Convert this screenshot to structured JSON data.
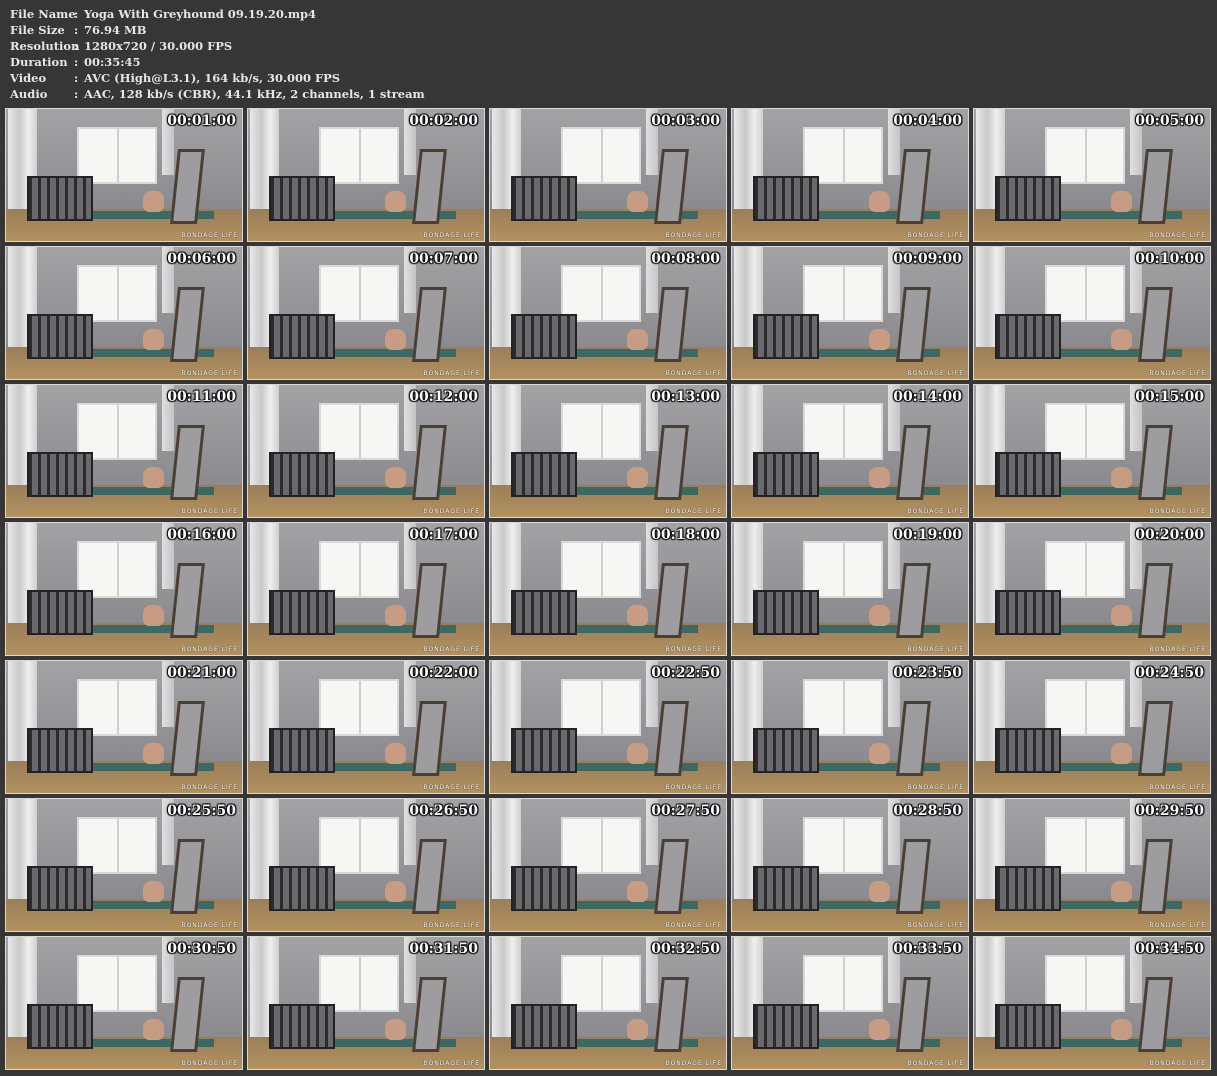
{
  "info": [
    {
      "label": "File Name",
      "sep": ":",
      "value": "Yoga With Greyhound 09.19.20.mp4"
    },
    {
      "label": "File Size",
      "sep": ":",
      "value": "76.94 MB"
    },
    {
      "label": "Resolution",
      "sep": ":",
      "value": "1280x720 / 30.000 FPS"
    },
    {
      "label": "Duration",
      "sep": ":",
      "value": "00:35:45"
    },
    {
      "label": "Video",
      "sep": ":",
      "value": "AVC (High@L3.1), 164 kb/s, 30.000 FPS"
    },
    {
      "label": "Audio",
      "sep": ":",
      "value": "AAC, 128 kb/s (CBR), 44.1 kHz, 2 channels, 1 stream"
    }
  ],
  "watermark": "BONDAGE LIFE",
  "thumbnails": [
    "00:01:00",
    "00:02:00",
    "00:03:00",
    "00:04:00",
    "00:05:00",
    "00:06:00",
    "00:07:00",
    "00:08:00",
    "00:09:00",
    "00:10:00",
    "00:11:00",
    "00:12:00",
    "00:13:00",
    "00:14:00",
    "00:15:00",
    "00:16:00",
    "00:17:00",
    "00:18:00",
    "00:19:00",
    "00:20:00",
    "00:21:00",
    "00:22:00",
    "00:22:50",
    "00:23:50",
    "00:24:50",
    "00:25:50",
    "00:26:50",
    "00:27:50",
    "00:28:50",
    "00:29:50",
    "00:30:50",
    "00:31:50",
    "00:32:50",
    "00:33:50",
    "00:34:50"
  ]
}
